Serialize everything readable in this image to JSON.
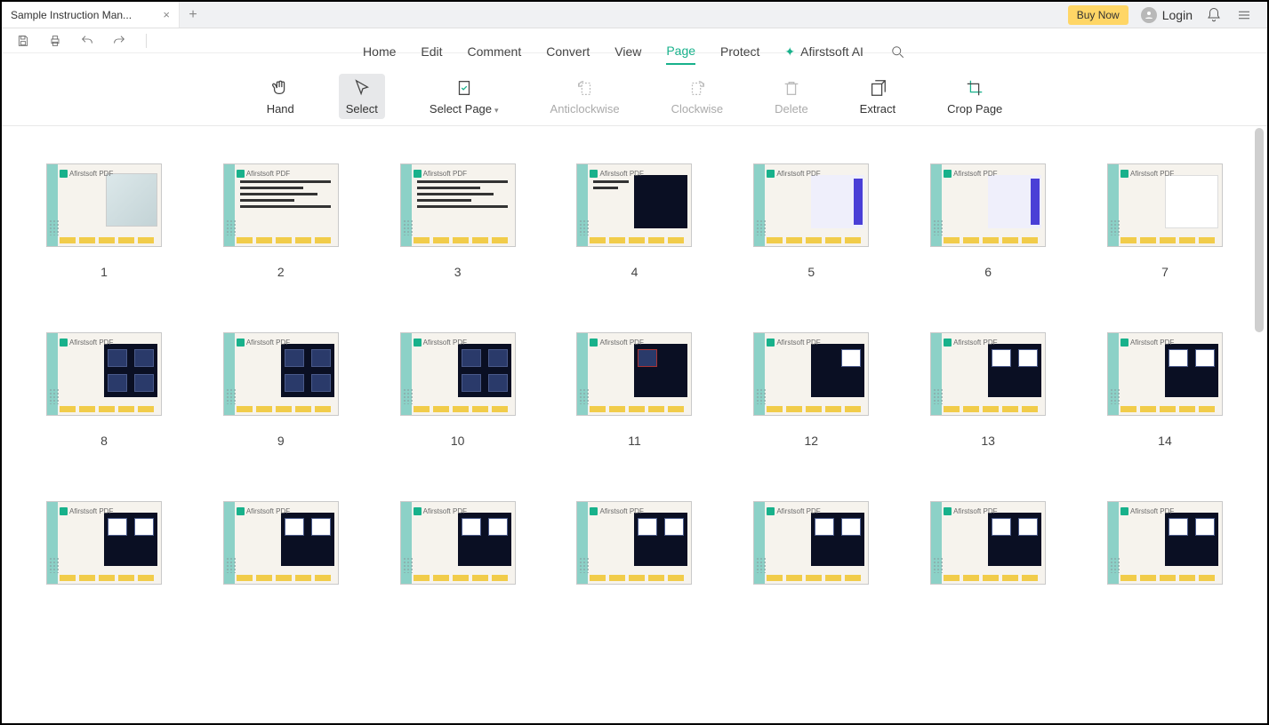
{
  "titlebar": {
    "tab_title": "Sample Instruction Man...",
    "buy_now": "Buy Now",
    "login": "Login"
  },
  "menu": {
    "items": [
      "Home",
      "Edit",
      "Comment",
      "Convert",
      "View",
      "Page",
      "Protect"
    ],
    "active_index": 5,
    "ai_label": "Afirstsoft AI"
  },
  "tools": {
    "hand": "Hand",
    "select": "Select",
    "select_page": "Select Page",
    "anticlockwise": "Anticlockwise",
    "clockwise": "Clockwise",
    "delete": "Delete",
    "extract": "Extract",
    "crop": "Crop Page"
  },
  "watermark": "Afirstsoft PDF",
  "pages": [
    "1",
    "2",
    "3",
    "4",
    "5",
    "6",
    "7",
    "8",
    "9",
    "10",
    "11",
    "12",
    "13",
    "14",
    "",
    "",
    "",
    "",
    "",
    "",
    ""
  ],
  "thumb_styles": [
    "cover",
    "toc",
    "toc",
    "intro",
    "purple",
    "purple",
    "white",
    "dark",
    "dark",
    "dark",
    "darkred",
    "darkwhite",
    "darkcards",
    "darkcards",
    "darkcards",
    "darkcards",
    "darkcards",
    "darkcards",
    "darkcards",
    "darkcards",
    "darkcards"
  ]
}
